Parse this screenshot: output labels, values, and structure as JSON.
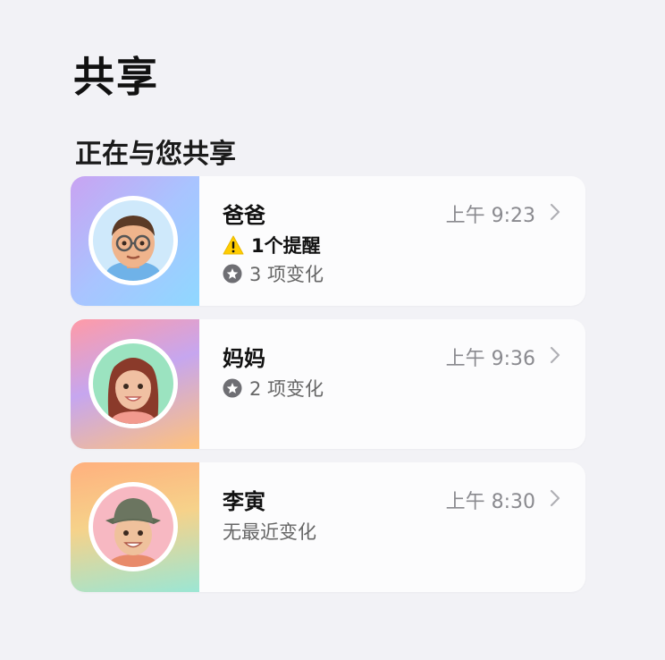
{
  "header": {
    "title": "共享"
  },
  "section": {
    "title": "正在与您共享"
  },
  "people": [
    {
      "name": "爸爸",
      "time": "上午 9:23",
      "alert": "1个提醒",
      "changes": "3 项变化",
      "avatar": "memoji-dad-icon",
      "panel_colors": [
        "#b6a6f4",
        "#8fd3ff"
      ]
    },
    {
      "name": "妈妈",
      "time": "上午 9:36",
      "changes": "2 项变化",
      "avatar": "memoji-mom-icon",
      "panel_colors": [
        "#ff9aa8",
        "#ffc47e"
      ]
    },
    {
      "name": "李寅",
      "time": "上午 8:30",
      "changes": "无最近变化",
      "avatar": "memoji-bucket-hat-icon",
      "panel_colors": [
        "#ffb27d",
        "#9be6d4"
      ]
    }
  ],
  "colors": {
    "background": "#f2f2f6",
    "card": "#fcfcfd",
    "secondary_text": "#8a8a8f",
    "warning": "#ffcc00"
  }
}
